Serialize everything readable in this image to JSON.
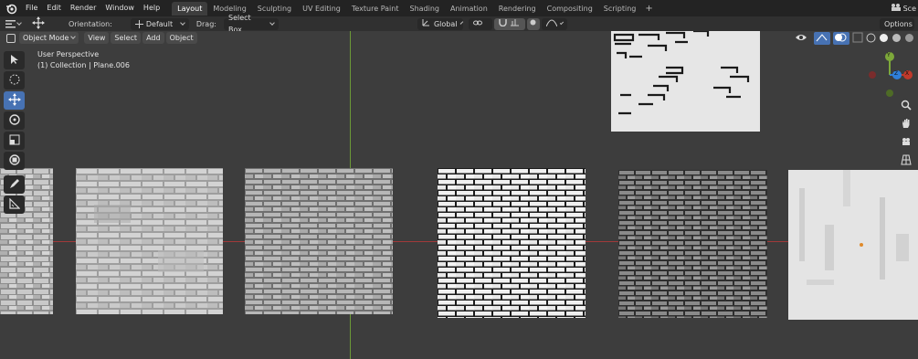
{
  "topbar": {
    "menus": [
      "File",
      "Edit",
      "Render",
      "Window",
      "Help"
    ],
    "workspaces": [
      "Layout",
      "Modeling",
      "Sculpting",
      "UV Editing",
      "Texture Paint",
      "Shading",
      "Animation",
      "Rendering",
      "Compositing",
      "Scripting"
    ],
    "active_workspace": "Layout",
    "add_tab": "+",
    "scene_label": "Sce"
  },
  "toolheader": {
    "orientation_label": "Orientation:",
    "orientation_value": "Default",
    "drag_label": "Drag:",
    "drag_value": "Select Box",
    "transform_orientation": "Global",
    "options_label": "Options"
  },
  "viewport_header": {
    "mode": "Object Mode",
    "menus": [
      "View",
      "Select",
      "Add",
      "Object"
    ]
  },
  "viewport": {
    "perspective": "User Perspective",
    "collection_info": "(1) Collection | Plane.006"
  },
  "gizmo": {
    "y": "Y",
    "z": "Z",
    "x": "X"
  },
  "colors": {
    "topbar_bg": "#232323",
    "viewport_bg": "#3d3d3d",
    "accent": "#4772b3",
    "x_axis": "#c0392b",
    "y_axis": "#7da83a",
    "z_axis": "#2f7ed8"
  },
  "textures": [
    "brick-light-partial",
    "brick-gray-mixed",
    "brick-gray-uniform",
    "brick-white-black-mortar",
    "brick-dark-gray",
    "plaster-white-patchy",
    "brick-white-sparse"
  ]
}
